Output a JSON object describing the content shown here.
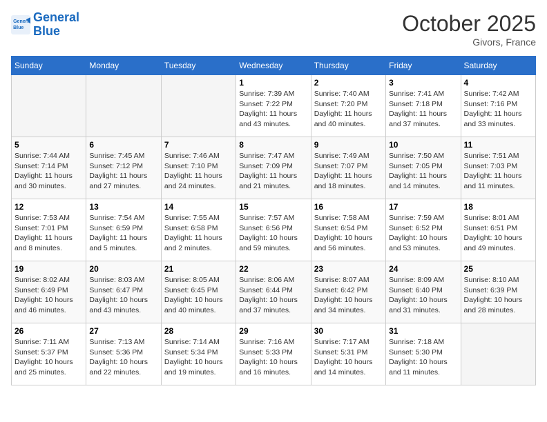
{
  "header": {
    "logo_line1": "General",
    "logo_line2": "Blue",
    "month": "October 2025",
    "location": "Givors, France"
  },
  "weekdays": [
    "Sunday",
    "Monday",
    "Tuesday",
    "Wednesday",
    "Thursday",
    "Friday",
    "Saturday"
  ],
  "weeks": [
    [
      {
        "day": "",
        "info": ""
      },
      {
        "day": "",
        "info": ""
      },
      {
        "day": "",
        "info": ""
      },
      {
        "day": "1",
        "info": "Sunrise: 7:39 AM\nSunset: 7:22 PM\nDaylight: 11 hours and 43 minutes."
      },
      {
        "day": "2",
        "info": "Sunrise: 7:40 AM\nSunset: 7:20 PM\nDaylight: 11 hours and 40 minutes."
      },
      {
        "day": "3",
        "info": "Sunrise: 7:41 AM\nSunset: 7:18 PM\nDaylight: 11 hours and 37 minutes."
      },
      {
        "day": "4",
        "info": "Sunrise: 7:42 AM\nSunset: 7:16 PM\nDaylight: 11 hours and 33 minutes."
      }
    ],
    [
      {
        "day": "5",
        "info": "Sunrise: 7:44 AM\nSunset: 7:14 PM\nDaylight: 11 hours and 30 minutes."
      },
      {
        "day": "6",
        "info": "Sunrise: 7:45 AM\nSunset: 7:12 PM\nDaylight: 11 hours and 27 minutes."
      },
      {
        "day": "7",
        "info": "Sunrise: 7:46 AM\nSunset: 7:10 PM\nDaylight: 11 hours and 24 minutes."
      },
      {
        "day": "8",
        "info": "Sunrise: 7:47 AM\nSunset: 7:09 PM\nDaylight: 11 hours and 21 minutes."
      },
      {
        "day": "9",
        "info": "Sunrise: 7:49 AM\nSunset: 7:07 PM\nDaylight: 11 hours and 18 minutes."
      },
      {
        "day": "10",
        "info": "Sunrise: 7:50 AM\nSunset: 7:05 PM\nDaylight: 11 hours and 14 minutes."
      },
      {
        "day": "11",
        "info": "Sunrise: 7:51 AM\nSunset: 7:03 PM\nDaylight: 11 hours and 11 minutes."
      }
    ],
    [
      {
        "day": "12",
        "info": "Sunrise: 7:53 AM\nSunset: 7:01 PM\nDaylight: 11 hours and 8 minutes."
      },
      {
        "day": "13",
        "info": "Sunrise: 7:54 AM\nSunset: 6:59 PM\nDaylight: 11 hours and 5 minutes."
      },
      {
        "day": "14",
        "info": "Sunrise: 7:55 AM\nSunset: 6:58 PM\nDaylight: 11 hours and 2 minutes."
      },
      {
        "day": "15",
        "info": "Sunrise: 7:57 AM\nSunset: 6:56 PM\nDaylight: 10 hours and 59 minutes."
      },
      {
        "day": "16",
        "info": "Sunrise: 7:58 AM\nSunset: 6:54 PM\nDaylight: 10 hours and 56 minutes."
      },
      {
        "day": "17",
        "info": "Sunrise: 7:59 AM\nSunset: 6:52 PM\nDaylight: 10 hours and 53 minutes."
      },
      {
        "day": "18",
        "info": "Sunrise: 8:01 AM\nSunset: 6:51 PM\nDaylight: 10 hours and 49 minutes."
      }
    ],
    [
      {
        "day": "19",
        "info": "Sunrise: 8:02 AM\nSunset: 6:49 PM\nDaylight: 10 hours and 46 minutes."
      },
      {
        "day": "20",
        "info": "Sunrise: 8:03 AM\nSunset: 6:47 PM\nDaylight: 10 hours and 43 minutes."
      },
      {
        "day": "21",
        "info": "Sunrise: 8:05 AM\nSunset: 6:45 PM\nDaylight: 10 hours and 40 minutes."
      },
      {
        "day": "22",
        "info": "Sunrise: 8:06 AM\nSunset: 6:44 PM\nDaylight: 10 hours and 37 minutes."
      },
      {
        "day": "23",
        "info": "Sunrise: 8:07 AM\nSunset: 6:42 PM\nDaylight: 10 hours and 34 minutes."
      },
      {
        "day": "24",
        "info": "Sunrise: 8:09 AM\nSunset: 6:40 PM\nDaylight: 10 hours and 31 minutes."
      },
      {
        "day": "25",
        "info": "Sunrise: 8:10 AM\nSunset: 6:39 PM\nDaylight: 10 hours and 28 minutes."
      }
    ],
    [
      {
        "day": "26",
        "info": "Sunrise: 7:11 AM\nSunset: 5:37 PM\nDaylight: 10 hours and 25 minutes."
      },
      {
        "day": "27",
        "info": "Sunrise: 7:13 AM\nSunset: 5:36 PM\nDaylight: 10 hours and 22 minutes."
      },
      {
        "day": "28",
        "info": "Sunrise: 7:14 AM\nSunset: 5:34 PM\nDaylight: 10 hours and 19 minutes."
      },
      {
        "day": "29",
        "info": "Sunrise: 7:16 AM\nSunset: 5:33 PM\nDaylight: 10 hours and 16 minutes."
      },
      {
        "day": "30",
        "info": "Sunrise: 7:17 AM\nSunset: 5:31 PM\nDaylight: 10 hours and 14 minutes."
      },
      {
        "day": "31",
        "info": "Sunrise: 7:18 AM\nSunset: 5:30 PM\nDaylight: 10 hours and 11 minutes."
      },
      {
        "day": "",
        "info": ""
      }
    ]
  ]
}
